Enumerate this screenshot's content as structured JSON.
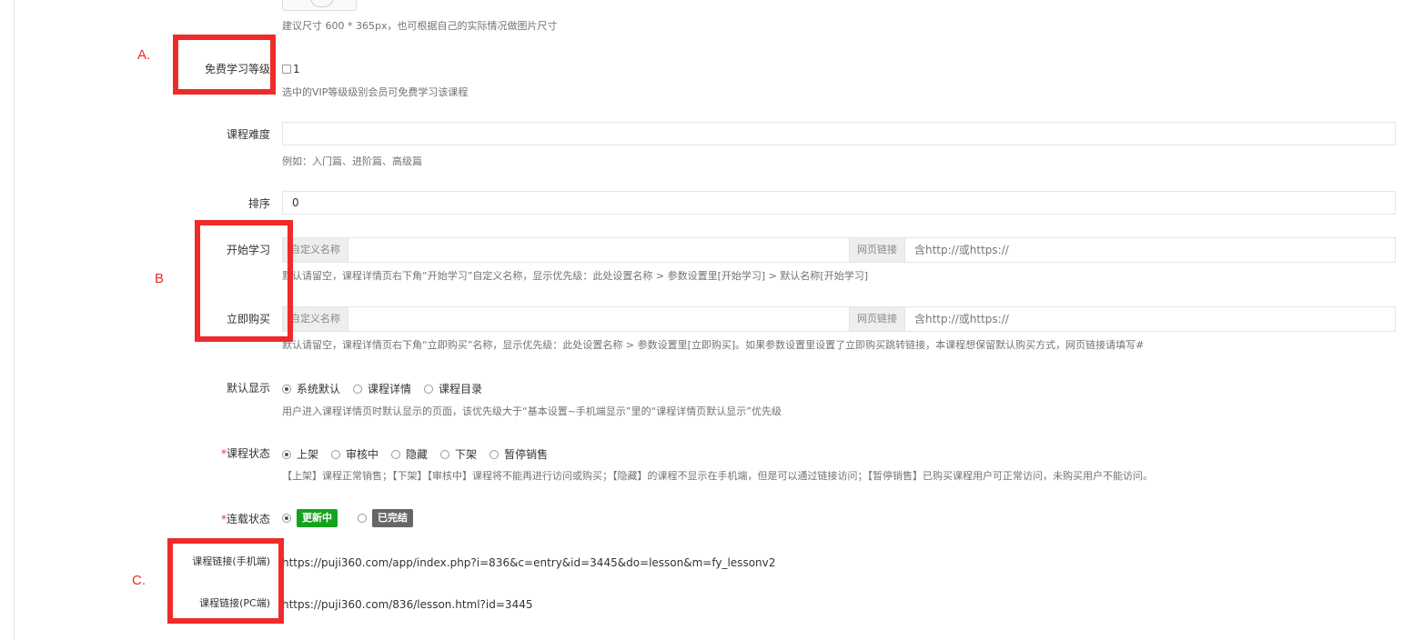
{
  "image_size_hint": {
    "help": "建议尺寸 600 * 365px，也可根据自己的实际情况做图片尺寸"
  },
  "free_level": {
    "label": "免费学习等级",
    "option": "1",
    "help": "选中的VIP等级级别会员可免费学习该课程"
  },
  "difficulty": {
    "label": "课程难度",
    "value": "",
    "help": "例如：入门篇、进阶篇、高级篇"
  },
  "sort": {
    "label": "排序",
    "value": "0"
  },
  "start_study": {
    "label": "开始学习",
    "name_addon": "自定义名称",
    "link_addon": "网页链接",
    "link_placeholder": "含http://或https://",
    "help": "默认请留空，课程详情页右下角“开始学习”自定义名称，显示优先级：此处设置名称 > 参数设置里[开始学习] > 默认名称[开始学习]"
  },
  "buy_now": {
    "label": "立即购买",
    "name_addon": "自定义名称",
    "link_addon": "网页链接",
    "link_placeholder": "含http://或https://",
    "help": "默认请留空，课程详情页右下角“立即购买”名称，显示优先级：此处设置名称 > 参数设置里[立即购买]。如果参数设置里设置了立即购买跳转链接，本课程想保留默认购买方式，网页链接请填写#"
  },
  "default_display": {
    "label": "默认显示",
    "options": [
      "系统默认",
      "课程详情",
      "课程目录"
    ],
    "selected": "系统默认",
    "help": "用户进入课程详情页时默认显示的页面，该优先级大于“基本设置~手机端显示”里的“课程详情页默认显示”优先级"
  },
  "course_status": {
    "required_mark": "*",
    "label": "课程状态",
    "options": [
      "上架",
      "审核中",
      "隐藏",
      "下架",
      "暂停销售"
    ],
    "selected": "上架",
    "help": "【上架】课程正常销售；【下架】【审核中】课程将不能再进行访问或购买；【隐藏】的课程不显示在手机端，但是可以通过链接访问；【暂停销售】已购买课程用户可正常访问，未购买用户不能访问。"
  },
  "serial_status": {
    "required_mark": "*",
    "label": "连载状态",
    "options": [
      "更新中",
      "已完结"
    ],
    "selected": "更新中",
    "colors": {
      "updating": "#16a21d",
      "finished": "#666666"
    }
  },
  "mobile_link": {
    "label": "课程链接(手机端)",
    "value": "https://puji360.com/app/index.php?i=836&c=entry&id=3445&do=lesson&m=fy_lessonv2"
  },
  "pc_link": {
    "label": "课程链接(PC端)",
    "value": "https://puji360.com/836/lesson.html?id=3445"
  },
  "annotations": {
    "a": "A.",
    "b": "B",
    "c": "C.",
    "color": "#ee2a2a"
  }
}
